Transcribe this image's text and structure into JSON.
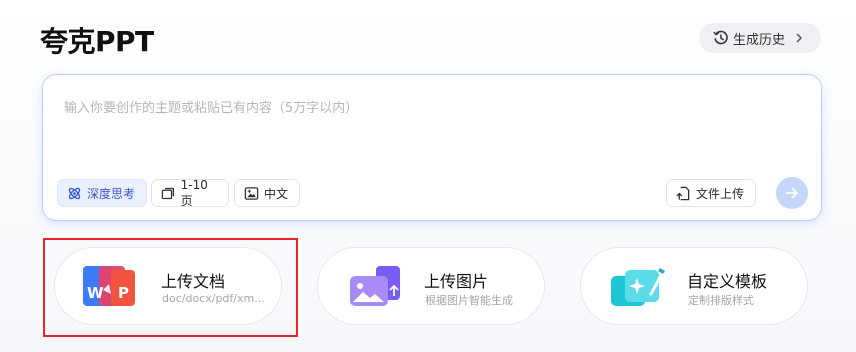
{
  "app": {
    "title": "夸克PPT"
  },
  "header": {
    "history_label": "生成历史"
  },
  "composer": {
    "placeholder": "输入你要创作的主题或粘贴已有内容（5万字以内）",
    "value": "",
    "chips": {
      "deep_think": "深度思考",
      "pages": "1-10页",
      "language": "中文"
    },
    "upload_label": "文件上传"
  },
  "cards": [
    {
      "title": "上传文档",
      "subtitle": "doc/docx/pdf/xm..."
    },
    {
      "title": "上传图片",
      "subtitle": "根据图片智能生成"
    },
    {
      "title": "自定义模板",
      "subtitle": "定制排版样式"
    }
  ],
  "doc_icon_letters": {
    "w": "W",
    "p": "P"
  },
  "colors": {
    "accent": "#3a57c9",
    "send_disabled": "#c6d6fb",
    "highlight": "#e8232a"
  },
  "icons": [
    "clock-history-icon",
    "chevron-right-icon",
    "atom-icon",
    "pages-icon",
    "image-text-icon",
    "upload-file-icon",
    "arrow-right-icon",
    "document-formats-icon",
    "image-upload-icon",
    "template-icon"
  ]
}
